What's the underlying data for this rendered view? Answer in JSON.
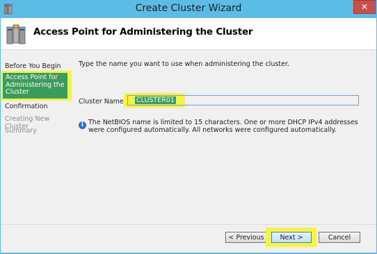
{
  "window": {
    "title": "Create Cluster Wizard",
    "close_symbol": "✕"
  },
  "header": {
    "title": "Access Point for Administering the Cluster",
    "icon": "cluster-server-icon"
  },
  "sidebar": {
    "items": [
      {
        "label": "Before You Begin",
        "state": "normal"
      },
      {
        "label": "Access Point for Administering the Cluster",
        "state": "current"
      },
      {
        "label": "Confirmation",
        "state": "normal"
      },
      {
        "label": "Creating New Cluster",
        "state": "disabled"
      },
      {
        "label": "Summary",
        "state": "disabled"
      }
    ]
  },
  "main": {
    "instruction": "Type the name you want to use when administering the cluster.",
    "cluster_name_label": "Cluster Name:",
    "cluster_name_value": "CLUSTER01",
    "info_icon_glyph": "i",
    "info_text": "The NetBIOS name is limited to 15 characters.  One or more DHCP IPv4 addresses were configured automatically.  All networks were configured automatically."
  },
  "buttons": {
    "previous": "< Previous",
    "next": "Next >",
    "cancel": "Cancel"
  },
  "colors": {
    "title_bar": "#5bbde6",
    "highlight": "#f3f34a",
    "selection": "#3c9b5a",
    "close_button": "#c7504b"
  }
}
